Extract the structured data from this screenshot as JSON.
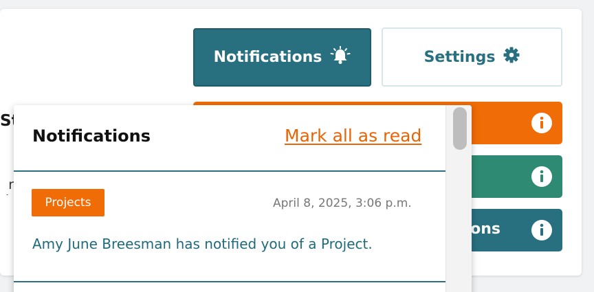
{
  "background_page": {
    "heading_partial": "St",
    "text_partial": "r h"
  },
  "header_buttons": {
    "notifications_label": "Notifications",
    "notifications_icon": "bell-ringing-icon",
    "settings_label": "Settings",
    "settings_icon": "gear-icon"
  },
  "side_buttons": [
    {
      "label": "",
      "color": "#ef6c06",
      "icon": "info-icon"
    },
    {
      "label": "",
      "color": "#2e8a72",
      "icon": "info-icon"
    },
    {
      "label": "ons",
      "color": "#286f80",
      "icon": "info-icon"
    }
  ],
  "notifications_panel": {
    "title": "Notifications",
    "mark_all_read": "Mark all as read",
    "items": [
      {
        "badge": "Projects",
        "badge_color": "#ef6c06",
        "timestamp": "April 8, 2025, 3:06 p.m.",
        "message": "Amy June Breesman has notified you of a Project."
      }
    ]
  },
  "colors": {
    "primary_teal": "#286f80",
    "accent_orange": "#ef6c06",
    "accent_green": "#2e8a72"
  }
}
